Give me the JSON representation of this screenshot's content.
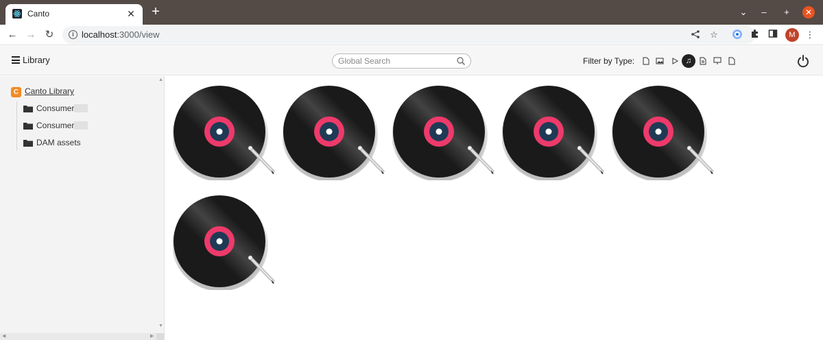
{
  "browser": {
    "tab_title": "Canto",
    "new_tab_label": "+",
    "url_host": "localhost",
    "url_rest": ":3000/view",
    "profile_initial": "M",
    "window_controls": [
      "chevron-down-icon",
      "minimize-icon",
      "maximize-icon",
      "close-icon"
    ]
  },
  "app": {
    "header_title": "Library",
    "search": {
      "placeholder": "Global Search"
    },
    "filter": {
      "label": "Filter by Type:",
      "types": [
        {
          "name": "document",
          "icon": "file-icon",
          "active": false
        },
        {
          "name": "image",
          "icon": "image-icon",
          "active": false
        },
        {
          "name": "video",
          "icon": "play-icon",
          "active": false
        },
        {
          "name": "audio",
          "icon": "music-icon",
          "active": true
        },
        {
          "name": "text",
          "icon": "text-file-icon",
          "active": false
        },
        {
          "name": "presentation",
          "icon": "presentation-icon",
          "active": false
        },
        {
          "name": "other",
          "icon": "blank-file-icon",
          "active": false
        }
      ]
    }
  },
  "sidebar": {
    "root": {
      "label": "Canto Library",
      "icon": "canto-logo-icon"
    },
    "folders": [
      {
        "label": "Consumer"
      },
      {
        "label": "Consumer"
      },
      {
        "label": "DAM assets"
      }
    ]
  },
  "assets": [
    {
      "type": "audio",
      "thumbnail": "vinyl-record"
    },
    {
      "type": "audio",
      "thumbnail": "vinyl-record"
    },
    {
      "type": "audio",
      "thumbnail": "vinyl-record"
    },
    {
      "type": "audio",
      "thumbnail": "vinyl-record"
    },
    {
      "type": "audio",
      "thumbnail": "vinyl-record"
    },
    {
      "type": "audio",
      "thumbnail": "vinyl-record"
    }
  ],
  "colors": {
    "record_label": "#ee3a6b",
    "record_center": "#1f3a55",
    "record_disc": "#1a1a1a",
    "canto_orange": "#f28b25"
  }
}
